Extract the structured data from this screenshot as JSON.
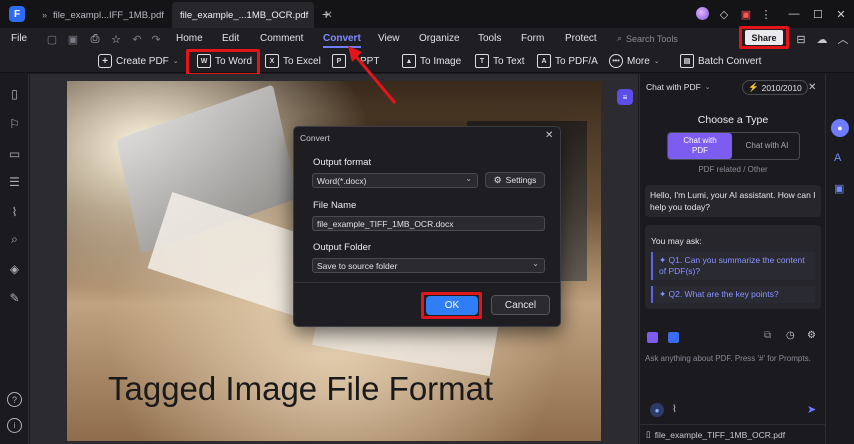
{
  "tabs": [
    {
      "label": "file_exampl...IFF_1MB.pdf"
    },
    {
      "label": "file_example_...1MB_OCR.pdf"
    }
  ],
  "menubar": {
    "file": "File",
    "items": [
      "Home",
      "Edit",
      "Comment",
      "Convert",
      "View",
      "Organize",
      "Tools",
      "Form",
      "Protect"
    ],
    "search_placeholder": "Search Tools",
    "share": "Share"
  },
  "toolbar": {
    "create_pdf": "Create PDF",
    "to_word": "To Word",
    "to_excel": "To Excel",
    "to_ppt": "PPT",
    "to_image": "To Image",
    "to_text": "To Text",
    "to_pdfa": "To PDF/A",
    "more": "More",
    "batch_convert": "Batch Convert"
  },
  "document": {
    "title_text": "Tagged Image File Format"
  },
  "dialog": {
    "title": "Convert",
    "output_format_label": "Output format",
    "output_format_value": "Word(*.docx)",
    "settings": "Settings",
    "file_name_label": "File Name",
    "file_name_value": "file_example_TIFF_1MB_OCR.docx",
    "output_folder_label": "Output Folder",
    "output_folder_value": "Save to source folder",
    "ok": "OK",
    "cancel": "Cancel"
  },
  "chat": {
    "mode": "Chat with PDF",
    "credits": "2010/2010",
    "choose_type": "Choose a Type",
    "type_pdf": "Chat with PDF",
    "type_ai": "Chat with AI",
    "hint": "PDF related / Other",
    "greeting": "Hello, I'm Lumi, your AI assistant. How can I help you today?",
    "you_may_ask": "You may ask:",
    "q1": "Q1. Can you summarize the content of PDF(s)?",
    "q2": "Q2. What are the key points?",
    "input_placeholder": "Ask anything about PDF. Press '#' for Prompts.",
    "file_name": "file_example_TIFF_1MB_OCR.pdf"
  },
  "colors": {
    "accent": "#6f7cff",
    "annotation_red": "#e3151b",
    "ok_button": "#2f7ef5"
  }
}
